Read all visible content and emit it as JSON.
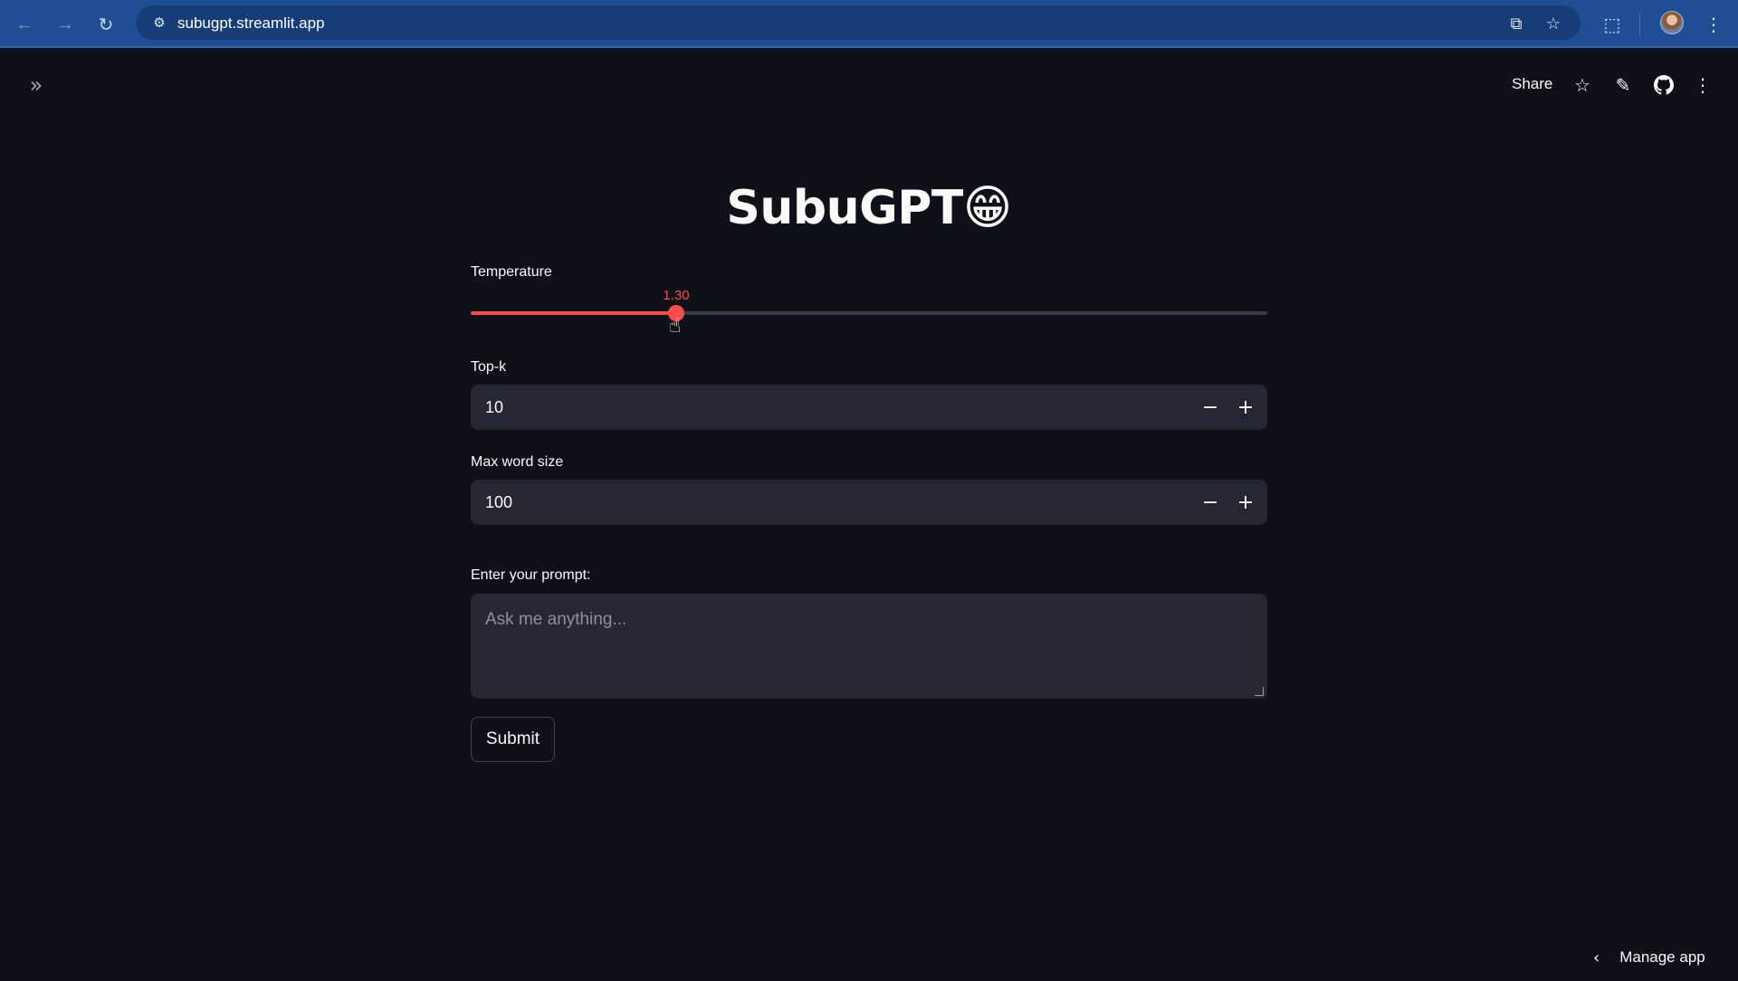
{
  "browser": {
    "url": "subugpt.streamlit.app",
    "icons": [
      "back-arrow-icon",
      "forward-arrow-icon",
      "reload-icon",
      "site-settings-icon",
      "install-app-icon",
      "bookmark-star-icon",
      "extensions-icon",
      "profile-avatar",
      "chrome-menu-icon"
    ]
  },
  "header": {
    "share_label": "Share",
    "icons": [
      "sidebar-expand-icon",
      "star-icon",
      "edit-pencil-icon",
      "github-icon",
      "more-menu-icon"
    ]
  },
  "main": {
    "title": "SubuGPT😁",
    "temperature": {
      "label": "Temperature",
      "value_text": "1.30",
      "fraction": 0.258
    },
    "top_k": {
      "label": "Top-k",
      "value": "10"
    },
    "max_word_size": {
      "label": "Max word size",
      "value": "100"
    },
    "prompt": {
      "label": "Enter your prompt:",
      "placeholder": "Ask me anything..."
    },
    "submit_label": "Submit"
  },
  "footer": {
    "manage_app_label": "Manage app"
  },
  "colors": {
    "background": "#0e1117",
    "accent": "#ff4b4b",
    "input_bg": "#262730",
    "browser_bar": "#1f4e94"
  }
}
